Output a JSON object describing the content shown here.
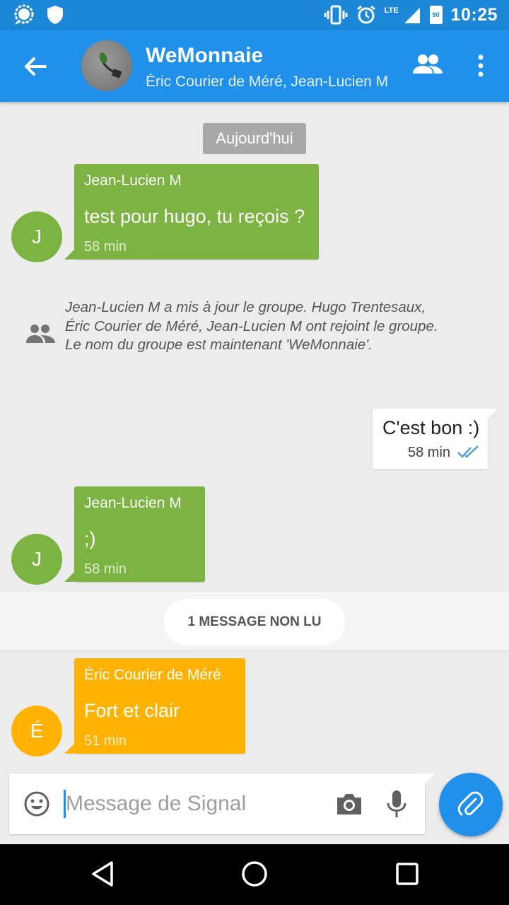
{
  "status_bar": {
    "time": "10:25",
    "network": "LTE",
    "battery": "90",
    "icons": [
      "signal-app-icon",
      "shield-icon",
      "vibrate-icon",
      "alarm-icon",
      "cell-signal-icon",
      "battery-icon"
    ]
  },
  "toolbar": {
    "title": "WeMonnaie",
    "subtitle": "Éric Courier de Méré, Jean-Lucien M",
    "icons": [
      "back-arrow-icon",
      "group-avatar",
      "members-icon",
      "overflow-menu-icon"
    ]
  },
  "conversation": {
    "date_divider": "Aujourd'hui",
    "messages": [
      {
        "sender": "Jean-Lucien M",
        "avatar": "J",
        "body": "test pour hugo, tu reçois ?",
        "time": "58 min"
      },
      {
        "sender": "Jean-Lucien M",
        "avatar": "J",
        "body": ";)",
        "time": "58 min"
      },
      {
        "sender": "Éric Courier de Méré",
        "avatar": "É",
        "body": "Fort et clair",
        "time": "51 min"
      }
    ],
    "group_update": "Jean-Lucien M a mis à jour le groupe. Hugo Trentesaux, Éric Courier de Méré, Jean-Lucien M ont rejoint le groupe. Le nom du groupe est maintenant 'WeMonnaie'.",
    "outgoing": {
      "body": "C'est bon :)",
      "time": "58 min",
      "status_icon": "double-check-icon"
    },
    "unread_label": "1 MESSAGE NON LU"
  },
  "composer": {
    "placeholder": "Message de Signal",
    "value": "",
    "icons": [
      "emoji-icon",
      "camera-icon",
      "mic-icon",
      "attach-icon"
    ]
  },
  "colors": {
    "primary": "#2090ea",
    "status_bar": "#1c86d7",
    "green_bubble": "#7cb342",
    "orange_bubble": "#ffb300",
    "background": "#ececec"
  }
}
